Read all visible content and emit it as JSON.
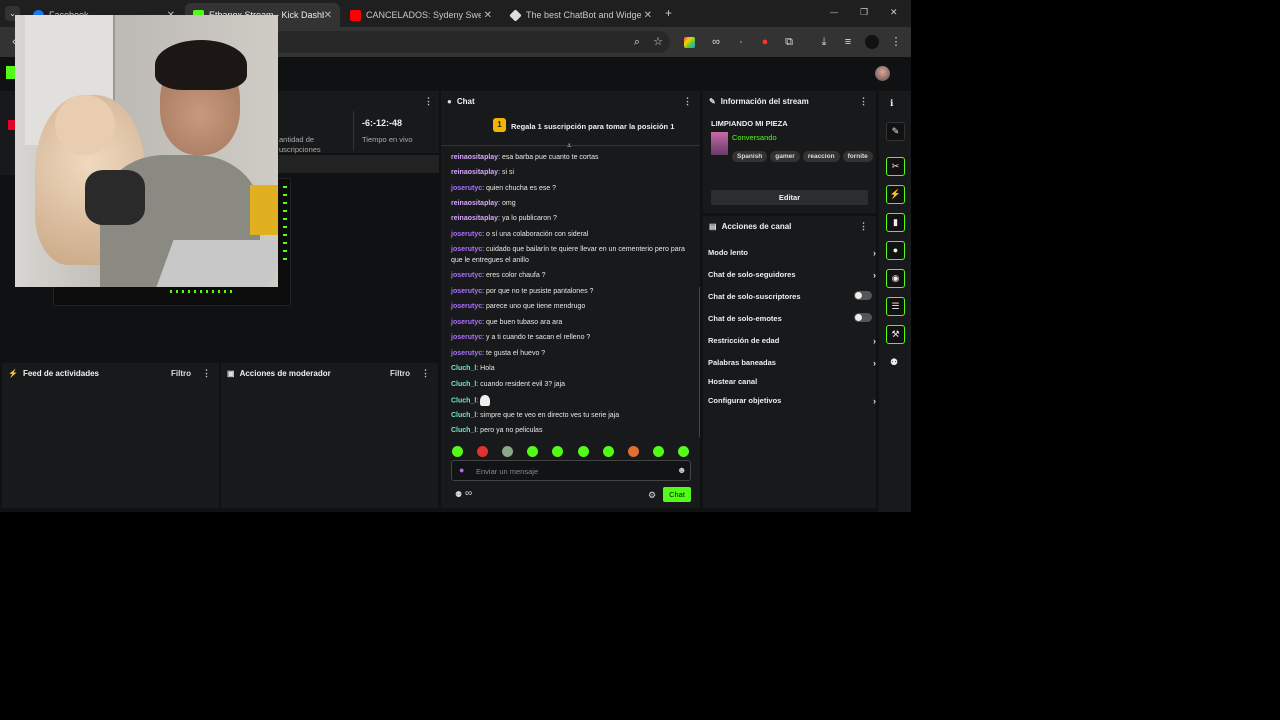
{
  "browser": {
    "tabs": [
      {
        "title": "Facebook",
        "fav": "#1877f2"
      },
      {
        "title": "Ethanox Stream - Kick Dashboard",
        "fav": "#53fc18"
      },
      {
        "title": "CANCELADOS: Sydeny Sweeney",
        "fav": "#ff0000"
      },
      {
        "title": "The best ChatBot and Widgets",
        "fav": "#dddddd"
      }
    ],
    "new_tab": "+",
    "window_controls": [
      "—",
      "❐",
      "✕"
    ]
  },
  "stats": {
    "subs_label_1": "antidad de",
    "subs_label_2": "uscripciones",
    "time_value": "-6:-12:-48",
    "time_label": "Tiempo en vivo"
  },
  "feed": {
    "title": "Feed de actividades",
    "filter": "Filtro"
  },
  "moderator": {
    "title": "Acciones de moderador",
    "filter": "Filtro"
  },
  "chat": {
    "title": "Chat",
    "banner_badge": "1",
    "banner_text": "Regala 1 suscripción para tomar la posición 1",
    "messages": [
      {
        "user": "reinaositaplay",
        "text": ": esa barba pue cuanto te cortas",
        "color": "#d6a6ff"
      },
      {
        "user": "reinaositaplay",
        "text": ": si si",
        "color": "#d6a6ff"
      },
      {
        "user": "joserutyc",
        "text": ": quien chucha es ese ?",
        "color": "#a970ff"
      },
      {
        "user": "reinaositaplay",
        "text": ": omg",
        "color": "#d6a6ff"
      },
      {
        "user": "reinaositaplay",
        "text": ": ya lo publicaron ?",
        "color": "#d6a6ff"
      },
      {
        "user": "joserutyc",
        "text": ": o sí una colaboración con sideral",
        "color": "#a970ff"
      },
      {
        "user": "joserutyc",
        "text": ": cuidado que bailarín te quiere llevar en un cementerio pero para que le entregues el anillo",
        "color": "#a970ff"
      },
      {
        "user": "joserutyc",
        "text": ": eres color chaufa ?",
        "color": "#a970ff"
      },
      {
        "user": "joserutyc",
        "text": ": por que no te pusiste pantalones ?",
        "color": "#a970ff"
      },
      {
        "user": "joserutyc",
        "text": ": parece uno que tiene mendrugo",
        "color": "#a970ff"
      },
      {
        "user": "joserutyc",
        "text": ": que buen tubaso ara ara",
        "color": "#a970ff"
      },
      {
        "user": "joserutyc",
        "text": ": y a ti cuando te sacan el relleno ?",
        "color": "#a970ff"
      },
      {
        "user": "joserutyc",
        "text": ": te gusta el huevo ?",
        "color": "#a970ff"
      },
      {
        "user": "Cluch_l",
        "text": ": Hola",
        "color": "#75e6c8"
      },
      {
        "user": "Cluch_l",
        "text": ": cuando resident evil 3? jaja",
        "color": "#75e6c8"
      },
      {
        "user": "Cluch_l",
        "text": ": ",
        "color": "#75e6c8"
      },
      {
        "user": "Cluch_l",
        "text": ": simpre que te veo en directo ves tu serie jaja",
        "color": "#75e6c8"
      },
      {
        "user": "Cluch_l",
        "text": ": pero ya no peliculas",
        "color": "#75e6c8"
      }
    ],
    "input_placeholder": "Enviar un mensaje",
    "send_label": "Chat",
    "infinity": "∞"
  },
  "stream_info": {
    "title": "Información del stream",
    "stream_title": "LIMPIANDO MI PIEZA",
    "category": "Conversando",
    "tags": [
      "Spanish",
      "gamer",
      "reaccion",
      "fornite"
    ],
    "edit_label": "Editar"
  },
  "channel_actions": {
    "title": "Acciones de canal",
    "items": [
      {
        "label": "Modo lento",
        "kind": "chevron"
      },
      {
        "label": "Chat de solo-seguidores",
        "kind": "chevron"
      },
      {
        "label": "Chat de solo-suscriptores",
        "kind": "toggle"
      },
      {
        "label": "Chat de solo-emotes",
        "kind": "toggle"
      },
      {
        "label": "Restricción de edad",
        "kind": "chevron"
      },
      {
        "label": "Palabras baneadas",
        "kind": "chevron"
      },
      {
        "label": "Hostear canal",
        "kind": "none"
      },
      {
        "label": "Configurar objetivos",
        "kind": "chevron"
      }
    ]
  },
  "colors": {
    "accent": "#53fc18",
    "panel": "#18191b",
    "bg": "#101112"
  }
}
